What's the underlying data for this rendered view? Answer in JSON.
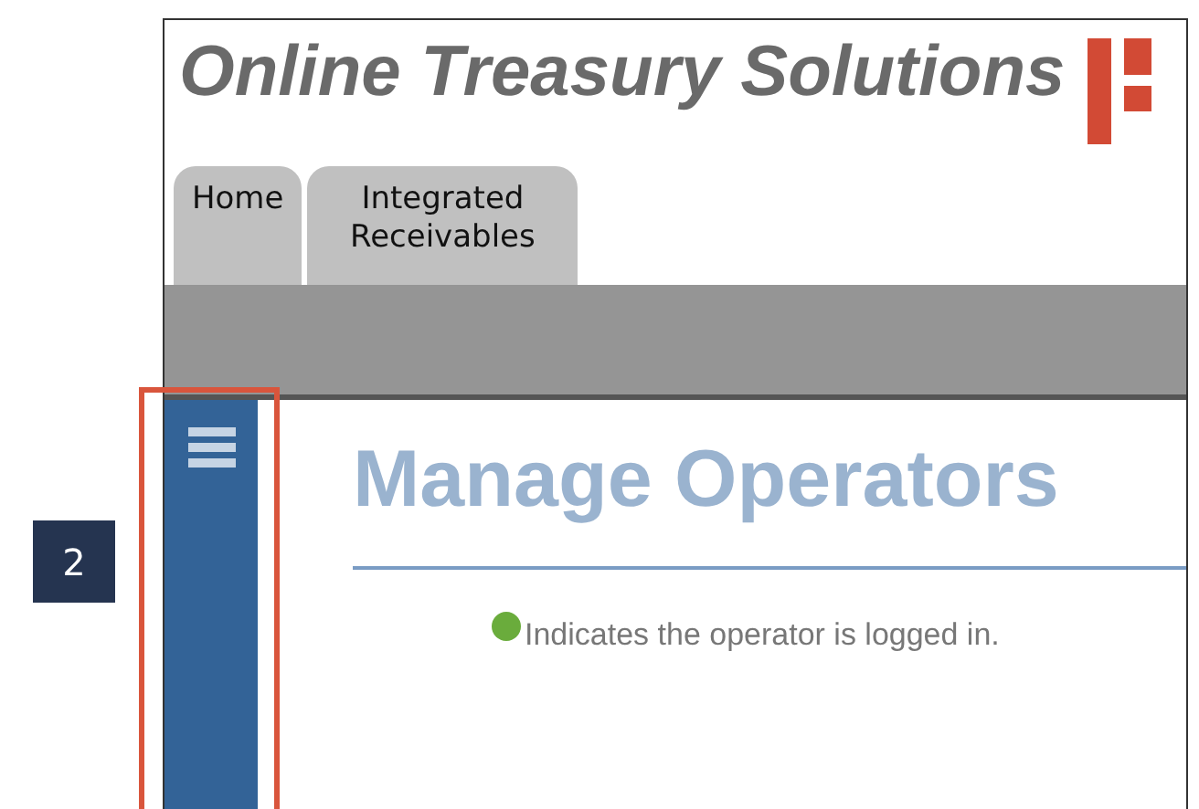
{
  "header": {
    "title": "Online Treasury Solutions"
  },
  "tabs": [
    {
      "label": "Home",
      "selected": false
    },
    {
      "label": "Integrated Receivables",
      "selected": false
    }
  ],
  "page": {
    "heading": "Manage Operators",
    "legend": {
      "text": "Indicates the operator is logged in.",
      "color": "#6aac3c"
    }
  },
  "callout": {
    "number": "2"
  }
}
